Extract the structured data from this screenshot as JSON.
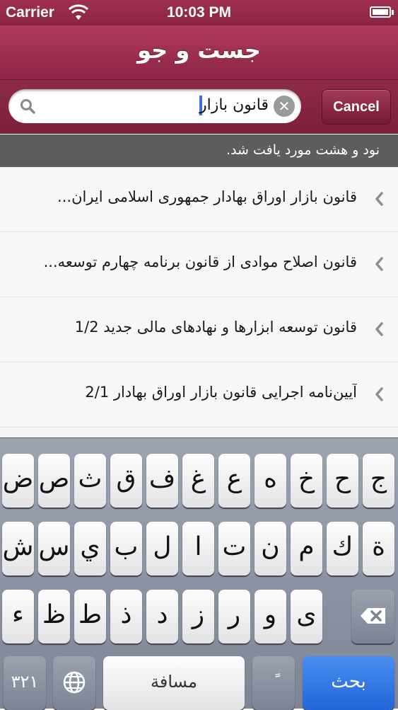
{
  "status_bar": {
    "carrier": "Carrier",
    "time": "10:03 PM",
    "wifi_icon": "wifi-icon",
    "battery_icon": "battery-icon"
  },
  "nav": {
    "title": "جست و جو"
  },
  "search": {
    "query": "قانون بازار",
    "clear_icon": "clear-icon",
    "search_icon": "search-icon",
    "cancel_label": "Cancel"
  },
  "results": {
    "summary": "نود و هشت مورد یافت شد.",
    "items": [
      {
        "title": "قانون بازار اوراق بهادار جمهوری اسلامی ایران..."
      },
      {
        "title": "قانون اصلاح موادی از قانون برنامه چهارم توسعه..."
      },
      {
        "title": "قانون توسعه ابزارها و نهادهای مالی جدید 1/2"
      },
      {
        "title": "آیین‌نامه اجرایی قانون بازار اوراق بهادار 2/1"
      }
    ]
  },
  "keyboard": {
    "row1": [
      "ج",
      "ح",
      "خ",
      "ه",
      "ع",
      "غ",
      "ف",
      "ق",
      "ث",
      "ص",
      "ض"
    ],
    "row2": [
      "ة",
      "ك",
      "م",
      "ن",
      "ت",
      "ا",
      "ل",
      "ب",
      "ي",
      "س",
      "ش"
    ],
    "row3": [
      "ی",
      "و",
      "ر",
      "ز",
      "د",
      "ذ",
      "ط",
      "ظ",
      "ء"
    ],
    "numbers_label": "۳۲۱",
    "globe_icon": "globe-icon",
    "space_label": "مسافة",
    "diacritic_label": "ً",
    "search_label": "بحث",
    "backspace_icon": "backspace-icon"
  },
  "colors": {
    "accent": "#8c2446",
    "keyboard_blue": "#2266d9"
  }
}
